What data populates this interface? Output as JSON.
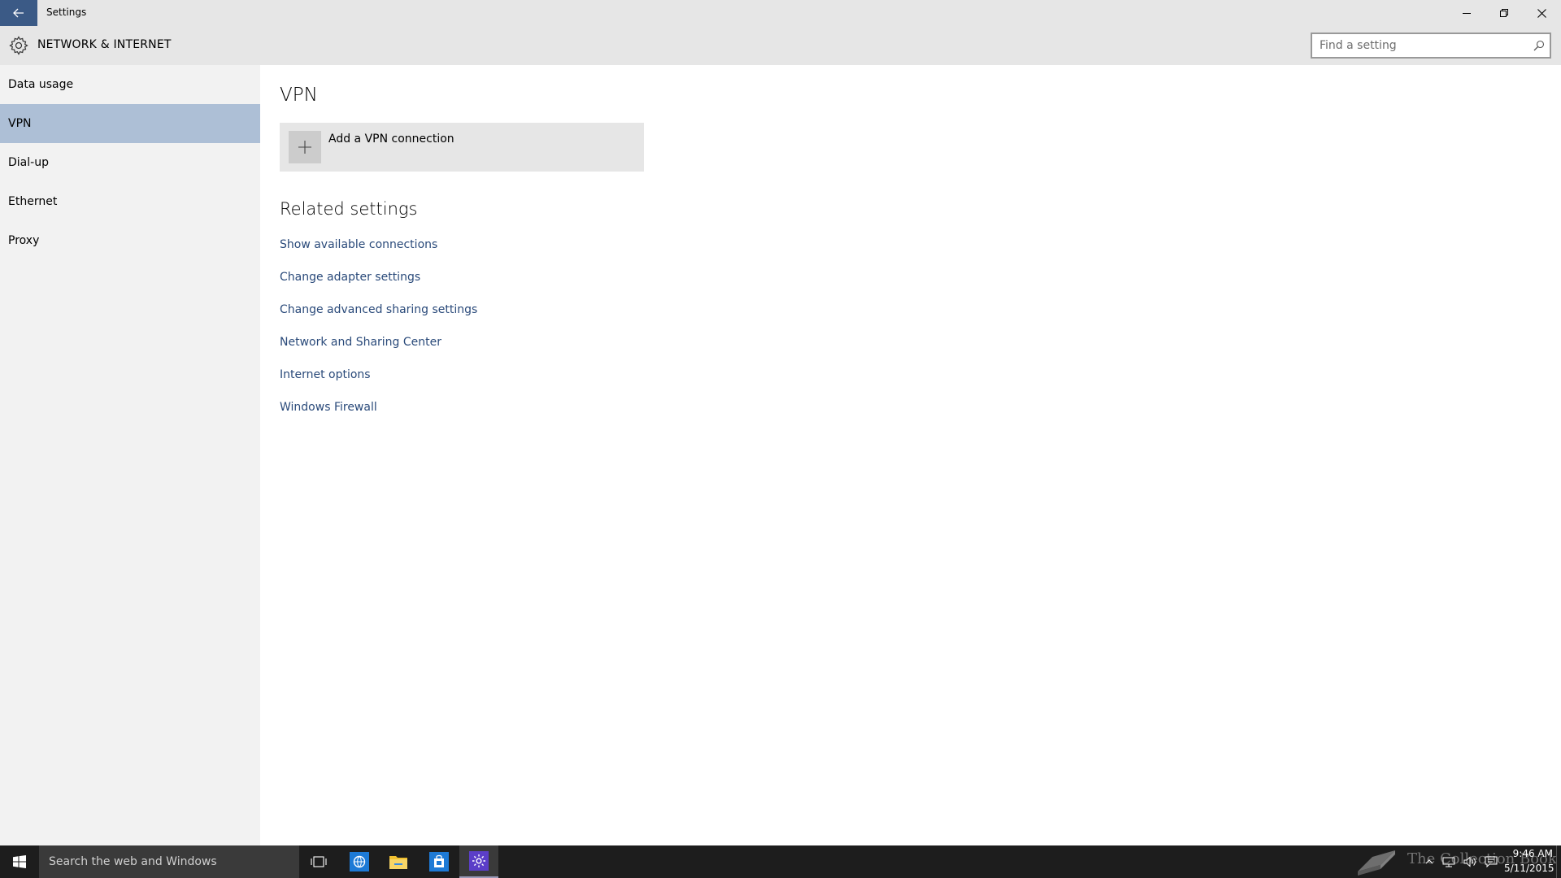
{
  "window": {
    "title": "Settings",
    "back_icon": "back-arrow-icon",
    "controls": [
      "minimize-icon",
      "restore-icon",
      "close-icon"
    ]
  },
  "header": {
    "title": "NETWORK & INTERNET",
    "icon": "gear-icon",
    "search": {
      "placeholder": "Find a setting",
      "value": "",
      "icon": "search-icon"
    }
  },
  "sidebar": {
    "items": [
      {
        "label": "Data usage",
        "selected": false
      },
      {
        "label": "VPN",
        "selected": true
      },
      {
        "label": "Dial-up",
        "selected": false
      },
      {
        "label": "Ethernet",
        "selected": false
      },
      {
        "label": "Proxy",
        "selected": false
      }
    ]
  },
  "main": {
    "title": "VPN",
    "add_vpn": {
      "label": "Add a VPN connection",
      "icon": "plus-icon"
    },
    "related": {
      "title": "Related settings",
      "links": [
        "Show available connections",
        "Change adapter settings",
        "Change advanced sharing settings",
        "Network and Sharing Center",
        "Internet options",
        "Windows Firewall"
      ]
    }
  },
  "taskbar": {
    "search_text": "Search the web and Windows",
    "apps": [
      "task-view-icon",
      "ie-icon",
      "file-explorer-icon",
      "store-icon",
      "settings-icon"
    ],
    "watermark": "The Collection Book",
    "tray_icons": [
      "chevron-up-icon",
      "network-icon",
      "volume-icon",
      "action-center-icon"
    ],
    "time": "9:46 AM",
    "date": "5/11/2015"
  },
  "colors": {
    "accent": "#3b5a86",
    "selected_item": "#adbfd6",
    "link": "#2a4a7a",
    "chrome": "#e6e6e6",
    "sidebar": "#f2f2f2",
    "taskbar": "#1d1d1d"
  }
}
